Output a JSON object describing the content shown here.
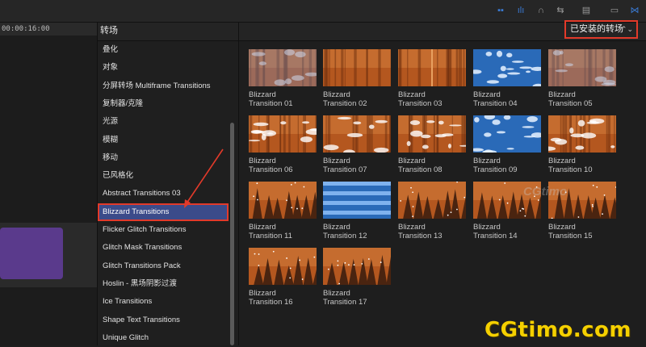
{
  "timeline": {
    "timecode": "00:00:16:00"
  },
  "sidebar": {
    "header": "转场",
    "items": [
      "叠化",
      "对象",
      "分屏转场 Multiframe Transitions",
      "复制器/克隆",
      "光源",
      "模糊",
      "移动",
      "已风格化",
      "Abstract Transitions 03",
      "Blizzard Transitions",
      "Flicker Glitch Transitions",
      "Glitch Mask Transitions",
      "Glitch Transitions Pack",
      "Hoslin - 黑场阴影过渡",
      "Ice Transitions",
      "Shape Text Transitions",
      "Unique Glitch"
    ],
    "selected_index": 9
  },
  "browser": {
    "selector_label": "已安装的转场",
    "transitions": [
      {
        "line1": "Blizzard",
        "line2": "Transition 01",
        "style": "swirl"
      },
      {
        "line1": "Blizzard",
        "line2": "Transition 02",
        "style": "orange"
      },
      {
        "line1": "Blizzard",
        "line2": "Transition 03",
        "style": "mirror"
      },
      {
        "line1": "Blizzard",
        "line2": "Transition 04",
        "style": "blue"
      },
      {
        "line1": "Blizzard",
        "line2": "Transition 05",
        "style": "swirl"
      },
      {
        "line1": "Blizzard",
        "line2": "Transition 06",
        "style": "streak"
      },
      {
        "line1": "Blizzard",
        "line2": "Transition 07",
        "style": "snow"
      },
      {
        "line1": "Blizzard",
        "line2": "Transition 08",
        "style": "streak"
      },
      {
        "line1": "Blizzard",
        "line2": "Transition 09",
        "style": "bluestreak"
      },
      {
        "line1": "Blizzard",
        "line2": "Transition 10",
        "style": "streak"
      },
      {
        "line1": "Blizzard",
        "line2": "Transition 11",
        "style": "forest"
      },
      {
        "line1": "Blizzard",
        "line2": "Transition 12",
        "style": "bluebands"
      },
      {
        "line1": "Blizzard",
        "line2": "Transition 13",
        "style": "forest"
      },
      {
        "line1": "Blizzard",
        "line2": "Transition 14",
        "style": "forest"
      },
      {
        "line1": "Blizzard",
        "line2": "Transition 15",
        "style": "forest"
      },
      {
        "line1": "Blizzard",
        "line2": "Transition 16",
        "style": "forest"
      },
      {
        "line1": "Blizzard",
        "line2": "Transition 17",
        "style": "forest"
      }
    ]
  },
  "watermarks": {
    "main": "CGtimo.com",
    "center": "CGtimo"
  },
  "colors": {
    "accent_red": "#e23a2a",
    "selection": "#3b4b8a",
    "brand_yellow": "#f5d000",
    "toolbar_blue": "#3a7bd5"
  }
}
